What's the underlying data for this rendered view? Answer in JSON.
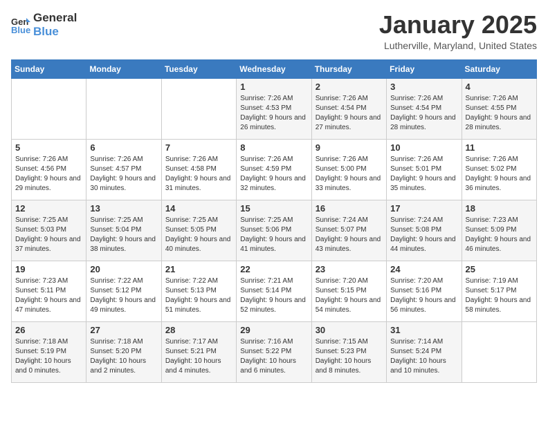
{
  "header": {
    "logo_general": "General",
    "logo_blue": "Blue",
    "month": "January 2025",
    "location": "Lutherville, Maryland, United States"
  },
  "weekdays": [
    "Sunday",
    "Monday",
    "Tuesday",
    "Wednesday",
    "Thursday",
    "Friday",
    "Saturday"
  ],
  "weeks": [
    [
      {
        "day": "",
        "sunrise": "",
        "sunset": "",
        "daylight": ""
      },
      {
        "day": "",
        "sunrise": "",
        "sunset": "",
        "daylight": ""
      },
      {
        "day": "",
        "sunrise": "",
        "sunset": "",
        "daylight": ""
      },
      {
        "day": "1",
        "sunrise": "Sunrise: 7:26 AM",
        "sunset": "Sunset: 4:53 PM",
        "daylight": "Daylight: 9 hours and 26 minutes."
      },
      {
        "day": "2",
        "sunrise": "Sunrise: 7:26 AM",
        "sunset": "Sunset: 4:54 PM",
        "daylight": "Daylight: 9 hours and 27 minutes."
      },
      {
        "day": "3",
        "sunrise": "Sunrise: 7:26 AM",
        "sunset": "Sunset: 4:54 PM",
        "daylight": "Daylight: 9 hours and 28 minutes."
      },
      {
        "day": "4",
        "sunrise": "Sunrise: 7:26 AM",
        "sunset": "Sunset: 4:55 PM",
        "daylight": "Daylight: 9 hours and 28 minutes."
      }
    ],
    [
      {
        "day": "5",
        "sunrise": "Sunrise: 7:26 AM",
        "sunset": "Sunset: 4:56 PM",
        "daylight": "Daylight: 9 hours and 29 minutes."
      },
      {
        "day": "6",
        "sunrise": "Sunrise: 7:26 AM",
        "sunset": "Sunset: 4:57 PM",
        "daylight": "Daylight: 9 hours and 30 minutes."
      },
      {
        "day": "7",
        "sunrise": "Sunrise: 7:26 AM",
        "sunset": "Sunset: 4:58 PM",
        "daylight": "Daylight: 9 hours and 31 minutes."
      },
      {
        "day": "8",
        "sunrise": "Sunrise: 7:26 AM",
        "sunset": "Sunset: 4:59 PM",
        "daylight": "Daylight: 9 hours and 32 minutes."
      },
      {
        "day": "9",
        "sunrise": "Sunrise: 7:26 AM",
        "sunset": "Sunset: 5:00 PM",
        "daylight": "Daylight: 9 hours and 33 minutes."
      },
      {
        "day": "10",
        "sunrise": "Sunrise: 7:26 AM",
        "sunset": "Sunset: 5:01 PM",
        "daylight": "Daylight: 9 hours and 35 minutes."
      },
      {
        "day": "11",
        "sunrise": "Sunrise: 7:26 AM",
        "sunset": "Sunset: 5:02 PM",
        "daylight": "Daylight: 9 hours and 36 minutes."
      }
    ],
    [
      {
        "day": "12",
        "sunrise": "Sunrise: 7:25 AM",
        "sunset": "Sunset: 5:03 PM",
        "daylight": "Daylight: 9 hours and 37 minutes."
      },
      {
        "day": "13",
        "sunrise": "Sunrise: 7:25 AM",
        "sunset": "Sunset: 5:04 PM",
        "daylight": "Daylight: 9 hours and 38 minutes."
      },
      {
        "day": "14",
        "sunrise": "Sunrise: 7:25 AM",
        "sunset": "Sunset: 5:05 PM",
        "daylight": "Daylight: 9 hours and 40 minutes."
      },
      {
        "day": "15",
        "sunrise": "Sunrise: 7:25 AM",
        "sunset": "Sunset: 5:06 PM",
        "daylight": "Daylight: 9 hours and 41 minutes."
      },
      {
        "day": "16",
        "sunrise": "Sunrise: 7:24 AM",
        "sunset": "Sunset: 5:07 PM",
        "daylight": "Daylight: 9 hours and 43 minutes."
      },
      {
        "day": "17",
        "sunrise": "Sunrise: 7:24 AM",
        "sunset": "Sunset: 5:08 PM",
        "daylight": "Daylight: 9 hours and 44 minutes."
      },
      {
        "day": "18",
        "sunrise": "Sunrise: 7:23 AM",
        "sunset": "Sunset: 5:09 PM",
        "daylight": "Daylight: 9 hours and 46 minutes."
      }
    ],
    [
      {
        "day": "19",
        "sunrise": "Sunrise: 7:23 AM",
        "sunset": "Sunset: 5:11 PM",
        "daylight": "Daylight: 9 hours and 47 minutes."
      },
      {
        "day": "20",
        "sunrise": "Sunrise: 7:22 AM",
        "sunset": "Sunset: 5:12 PM",
        "daylight": "Daylight: 9 hours and 49 minutes."
      },
      {
        "day": "21",
        "sunrise": "Sunrise: 7:22 AM",
        "sunset": "Sunset: 5:13 PM",
        "daylight": "Daylight: 9 hours and 51 minutes."
      },
      {
        "day": "22",
        "sunrise": "Sunrise: 7:21 AM",
        "sunset": "Sunset: 5:14 PM",
        "daylight": "Daylight: 9 hours and 52 minutes."
      },
      {
        "day": "23",
        "sunrise": "Sunrise: 7:20 AM",
        "sunset": "Sunset: 5:15 PM",
        "daylight": "Daylight: 9 hours and 54 minutes."
      },
      {
        "day": "24",
        "sunrise": "Sunrise: 7:20 AM",
        "sunset": "Sunset: 5:16 PM",
        "daylight": "Daylight: 9 hours and 56 minutes."
      },
      {
        "day": "25",
        "sunrise": "Sunrise: 7:19 AM",
        "sunset": "Sunset: 5:17 PM",
        "daylight": "Daylight: 9 hours and 58 minutes."
      }
    ],
    [
      {
        "day": "26",
        "sunrise": "Sunrise: 7:18 AM",
        "sunset": "Sunset: 5:19 PM",
        "daylight": "Daylight: 10 hours and 0 minutes."
      },
      {
        "day": "27",
        "sunrise": "Sunrise: 7:18 AM",
        "sunset": "Sunset: 5:20 PM",
        "daylight": "Daylight: 10 hours and 2 minutes."
      },
      {
        "day": "28",
        "sunrise": "Sunrise: 7:17 AM",
        "sunset": "Sunset: 5:21 PM",
        "daylight": "Daylight: 10 hours and 4 minutes."
      },
      {
        "day": "29",
        "sunrise": "Sunrise: 7:16 AM",
        "sunset": "Sunset: 5:22 PM",
        "daylight": "Daylight: 10 hours and 6 minutes."
      },
      {
        "day": "30",
        "sunrise": "Sunrise: 7:15 AM",
        "sunset": "Sunset: 5:23 PM",
        "daylight": "Daylight: 10 hours and 8 minutes."
      },
      {
        "day": "31",
        "sunrise": "Sunrise: 7:14 AM",
        "sunset": "Sunset: 5:24 PM",
        "daylight": "Daylight: 10 hours and 10 minutes."
      },
      {
        "day": "",
        "sunrise": "",
        "sunset": "",
        "daylight": ""
      }
    ]
  ]
}
